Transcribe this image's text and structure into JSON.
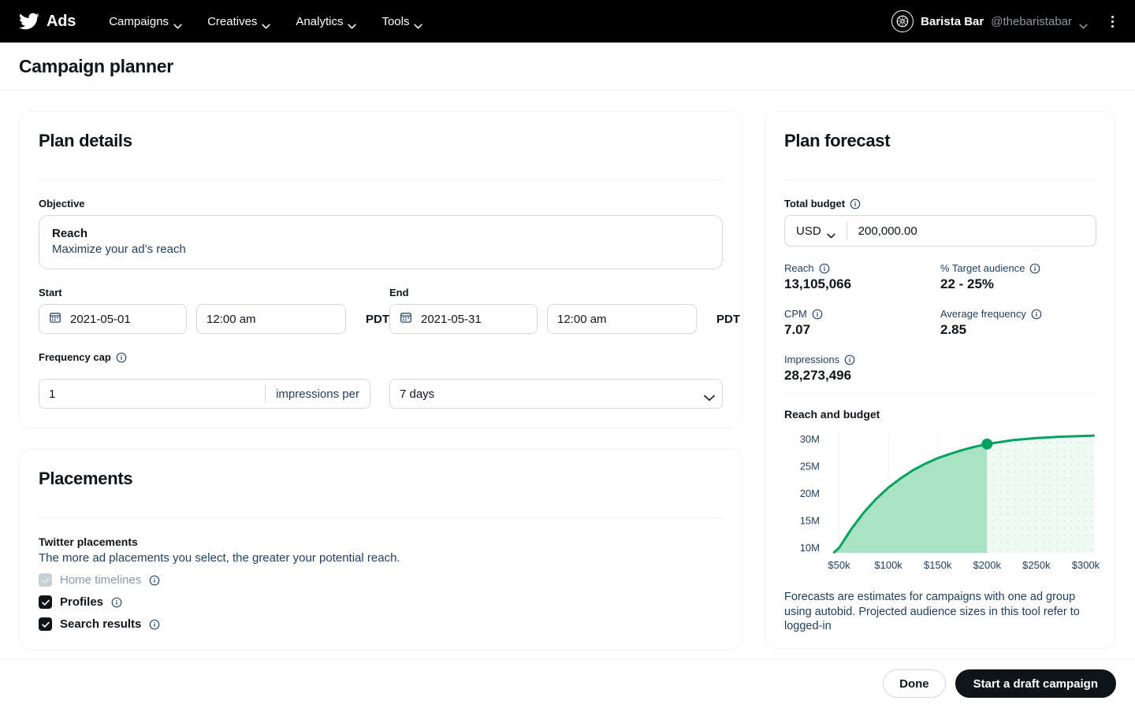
{
  "topnav": {
    "brand": "Ads",
    "brand_icon": "twitter-bird-icon",
    "items": [
      {
        "label": "Campaigns",
        "icon": "chevron-down-icon"
      },
      {
        "label": "Creatives",
        "icon": "chevron-down-icon"
      },
      {
        "label": "Analytics",
        "icon": "chevron-down-icon"
      },
      {
        "label": "Tools",
        "icon": "chevron-down-icon"
      }
    ],
    "account": {
      "name": "Barista Bar",
      "handle": "@thebaristabar",
      "avatar_icon": "account-avatar-icon",
      "chevron_icon": "chevron-down-icon",
      "overflow_icon": "kebab-menu-icon"
    }
  },
  "page": {
    "title": "Campaign planner"
  },
  "plan_details": {
    "title": "Plan details",
    "objective": {
      "label": "Objective",
      "name": "Reach",
      "description": "Maximize your ad’s reach"
    },
    "start": {
      "label": "Start",
      "date": "2021-05-01",
      "time": "12:00 am",
      "timezone": "PDT",
      "calendar_icon": "calendar-icon"
    },
    "end": {
      "label": "End",
      "date": "2021-05-31",
      "time": "12:00 am",
      "timezone": "PDT",
      "calendar_icon": "calendar-icon"
    },
    "frequency_cap": {
      "label": "Frequency cap",
      "info_icon": "info-icon",
      "value": "1",
      "suffix": "impressions per",
      "period": "7 days",
      "period_chevron_icon": "chevron-down-icon"
    }
  },
  "placements": {
    "title": "Placements",
    "group_label": "Twitter placements",
    "group_description": "The more ad placements you select, the greater your potential reach.",
    "options": [
      {
        "label": "Home timelines",
        "checked": true,
        "disabled": true,
        "info_icon": "info-icon",
        "check_icon": "check-icon"
      },
      {
        "label": "Profiles",
        "checked": true,
        "disabled": false,
        "info_icon": "info-icon",
        "check_icon": "check-icon"
      },
      {
        "label": "Search results",
        "checked": true,
        "disabled": false,
        "info_icon": "info-icon",
        "check_icon": "check-icon"
      }
    ]
  },
  "plan_forecast": {
    "title": "Plan forecast",
    "total_budget": {
      "label": "Total budget",
      "info_icon": "info-icon",
      "currency": "USD",
      "currency_chevron_icon": "chevron-down-icon",
      "amount": "200,000.00"
    },
    "metrics": [
      {
        "label": "Reach",
        "value": "13,105,066",
        "info_icon": "info-icon"
      },
      {
        "label": "% Target audience",
        "value": "22 - 25%",
        "info_icon": "info-icon"
      },
      {
        "label": "CPM",
        "value": "7.07",
        "info_icon": "info-icon"
      },
      {
        "label": "Average frequency",
        "value": "2.85",
        "info_icon": "info-icon"
      },
      {
        "label": "Impressions",
        "value": "28,273,496",
        "info_icon": "info-icon"
      }
    ],
    "footnote": "Forecasts are estimates for campaigns with one ad group using autobid. Projected audience sizes in this tool refer to logged-in"
  },
  "chart_data": {
    "type": "area",
    "title": "Reach and budget",
    "xlabel": "",
    "ylabel": "",
    "x_tick_labels": [
      "$50k",
      "$100k",
      "$150k",
      "$200k",
      "$250k",
      "$300k"
    ],
    "x_tick_values": [
      50000,
      100000,
      150000,
      200000,
      250000,
      300000
    ],
    "y_tick_labels": [
      "10M",
      "15M",
      "20M",
      "25M",
      "30M"
    ],
    "y_tick_values": [
      10000000,
      15000000,
      20000000,
      25000000,
      30000000
    ],
    "xlim": [
      40000,
      310000
    ],
    "ylim": [
      9000000,
      31000000
    ],
    "grid": "vertical",
    "legend": "none",
    "series": [
      {
        "name": "Reach",
        "x": [
          45000,
          50000,
          62500,
          75000,
          87500,
          100000,
          112500,
          125000,
          137500,
          150000,
          162500,
          175000,
          187500,
          200000,
          225000,
          250000,
          275000,
          300000,
          308000
        ],
        "y": [
          9100000,
          9900000,
          13400000,
          16400000,
          18900000,
          21000000,
          22700000,
          24200000,
          25400000,
          26400000,
          27200000,
          27900000,
          28500000,
          29000000,
          29700000,
          30100000,
          30350000,
          30500000,
          30550000
        ]
      }
    ],
    "marker": {
      "x": 200000,
      "y": 29000000,
      "label": "$200k",
      "color": "#00a25f"
    },
    "colors": {
      "line": "#00a25f",
      "area_selected": "#a9e2c4",
      "area_projected": "#e8f8f0",
      "axis_text": "#1d3d5c",
      "gridline": "#eef1f3"
    }
  },
  "bottom_bar": {
    "done_label": "Done",
    "primary_label": "Start a draft campaign"
  }
}
